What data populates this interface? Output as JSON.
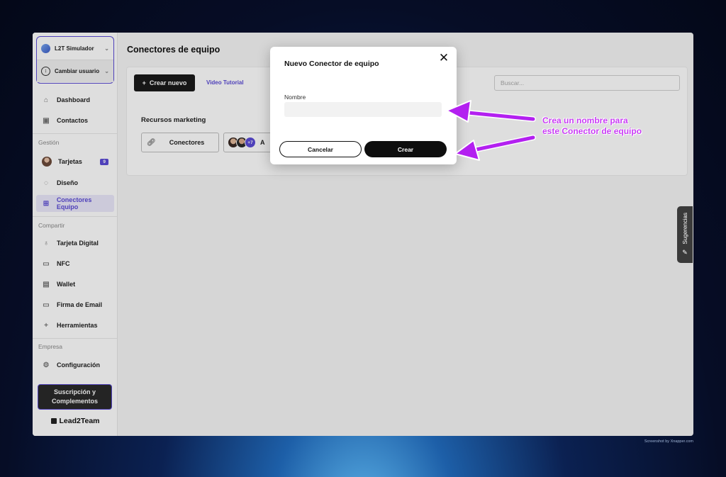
{
  "sidebar": {
    "account": "L2T Simulador",
    "switch_user": "Cambiar usuario",
    "items": [
      {
        "label": "Dashboard"
      },
      {
        "label": "Contactos"
      },
      {
        "label": "Tarjetas",
        "badge": "9"
      },
      {
        "label": "Diseño"
      },
      {
        "label": "Conectores Equipo"
      },
      {
        "label": "Tarjeta Digital"
      },
      {
        "label": "NFC"
      },
      {
        "label": "Wallet"
      },
      {
        "label": "Firma de Email"
      },
      {
        "label": "Herramientas"
      },
      {
        "label": "Configuración"
      }
    ],
    "sections": {
      "gestion": "Gestión",
      "compartir": "Compartir",
      "empresa": "Empresa"
    },
    "subscribe_line1": "Suscripción y",
    "subscribe_line2": "Complementos",
    "brand": "Lead2Team"
  },
  "main": {
    "page_title": "Conectores de equipo",
    "create_new": "Crear nuevo",
    "tutorial": "Video Tutorial",
    "search_placeholder": "Buscar...",
    "group_title": "Recursos marketing",
    "connectors_label": "Conectores",
    "team_more": "+7",
    "team_label": "A"
  },
  "suggestions_tab": "Sugerencias",
  "modal": {
    "title": "Nuevo Conector de equipo",
    "field_label": "Nombre",
    "name_value": "",
    "cancel": "Cancelar",
    "create": "Crear"
  },
  "annotation": {
    "line1": "Crea un nombre  para",
    "line2": "este Conector de equipo",
    "color": "#c93cf5"
  },
  "credit": "Screenshot by Xnapper.com",
  "colors": {
    "accent": "#5b4bd6",
    "dark_button": "#1a1a1a"
  }
}
